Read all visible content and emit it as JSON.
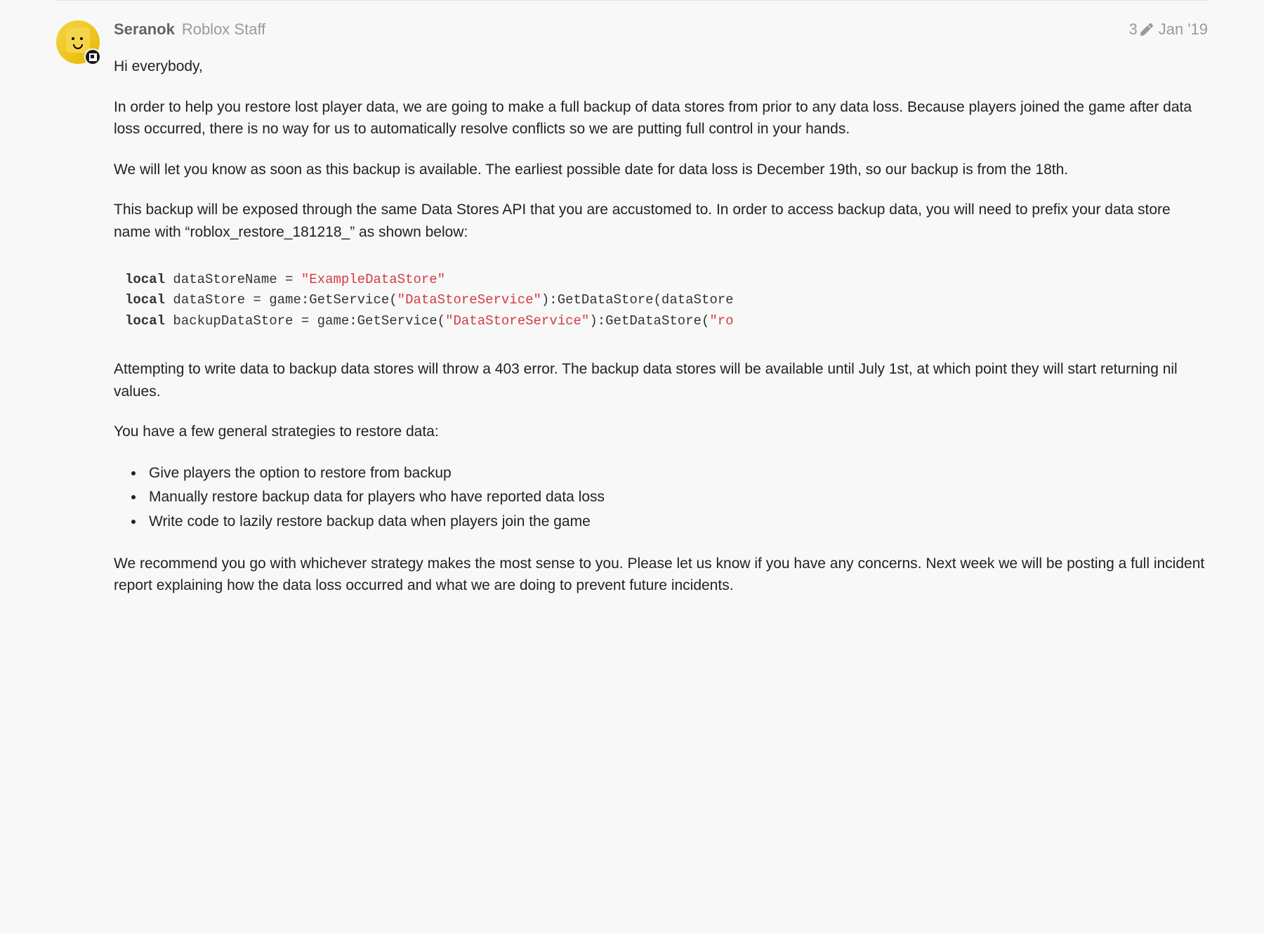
{
  "post": {
    "author": {
      "name": "Seranok",
      "title": "Roblox Staff"
    },
    "meta": {
      "edit_count": "3",
      "date": "Jan '19"
    },
    "content": {
      "greeting": "Hi everybody,",
      "para1": "In order to help you restore lost player data, we are going to make a full backup of data stores from prior to any data loss. Because players joined the game after data loss occurred, there is no way for us to automatically resolve conflicts so we are putting full control in your hands.",
      "para2": "We will let you know as soon as this backup is available. The earliest possible date for data loss is December 19th, so our backup is from the 18th.",
      "para3": "This backup will be exposed through the same Data Stores API that you are accustomed to. In order to access backup data, you will need to prefix your data store name with “roblox_restore_181218_” as shown below:",
      "code": {
        "line1_kw": "local",
        "line1_var": " dataStoreName = ",
        "line1_str": "\"ExampleDataStore\"",
        "line2_kw": "local",
        "line2_a": " dataStore = game:GetService(",
        "line2_str": "\"DataStoreService\"",
        "line2_b": "):GetDataStore(dataStore",
        "line3_kw": "local",
        "line3_a": " backupDataStore = game:GetService(",
        "line3_str": "\"DataStoreService\"",
        "line3_b": "):GetDataStore(",
        "line3_str2": "\"ro"
      },
      "para4": "Attempting to write data to backup data stores will throw a 403 error. The backup data stores will be available until July 1st, at which point they will start returning nil values.",
      "para5": "You have a few general strategies to restore data:",
      "strategies": [
        "Give players the option to restore from backup",
        "Manually restore backup data for players who have reported data loss",
        "Write code to lazily restore backup data when players join the game"
      ],
      "para6": "We recommend you go with whichever strategy makes the most sense to you. Please let us know if you have any concerns. Next week we will be posting a full incident report explaining how the data loss occurred and what we are doing to prevent future incidents."
    }
  }
}
